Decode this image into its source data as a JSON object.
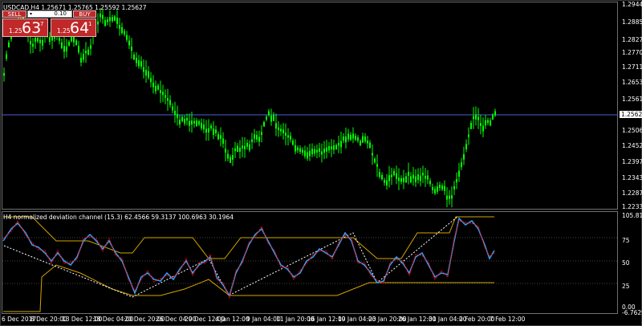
{
  "chart": {
    "title": "USDCAD,H4  1.25671 1.25765 1.25592 1.25627",
    "current_price": "1.25627",
    "price_levels": [
      "1.29445",
      "1.28850",
      "1.28270",
      "1.27700",
      "1.27115",
      "1.26530",
      "1.25610",
      "1.25065",
      "1.24525",
      "1.23970",
      "1.23430",
      "1.22875",
      "1.22335"
    ],
    "time_labels": [
      "6 Dec 2017",
      "8 Dec 20:00",
      "13 Dec 12:00",
      "18 Dec 04:00",
      "20 Dec 20:00",
      "26 Dec 04:00",
      "29 Dec 12:00",
      "4 Jan 12:00",
      "9 Jan 04:00",
      "11 Jan 20:00",
      "16 Jan 12:00",
      "19 Jan 04:00",
      "23 Jan 20:00",
      "26 Jan 12:00",
      "31 Jan 04:00",
      "2 Feb 20:00",
      "7 Feb 12:00"
    ],
    "colors": {
      "bull": "#00ff00",
      "bear": "#00ff00",
      "grid": "#1e1e1e"
    }
  },
  "trade_panel": {
    "sell_label": "SELL",
    "buy_label": "BUY",
    "lot_value": "0.10",
    "sell_prefix": "1.25",
    "sell_big": "63",
    "sell_sup": "7",
    "buy_prefix": "1.25",
    "buy_big": "64",
    "buy_sup": "1"
  },
  "indicator": {
    "title": "H4  normalized deviation channel (15.3) 62.4566 59.3137 100.6963 30.1964",
    "levels": [
      "105.8148",
      "75",
      "50",
      "25",
      "0.00",
      "-6.7629"
    ],
    "colors": {
      "main": "#2ea3ff",
      "signal": "#ff0000",
      "channel": "#d4a300",
      "diag": "#ffffff"
    }
  }
}
